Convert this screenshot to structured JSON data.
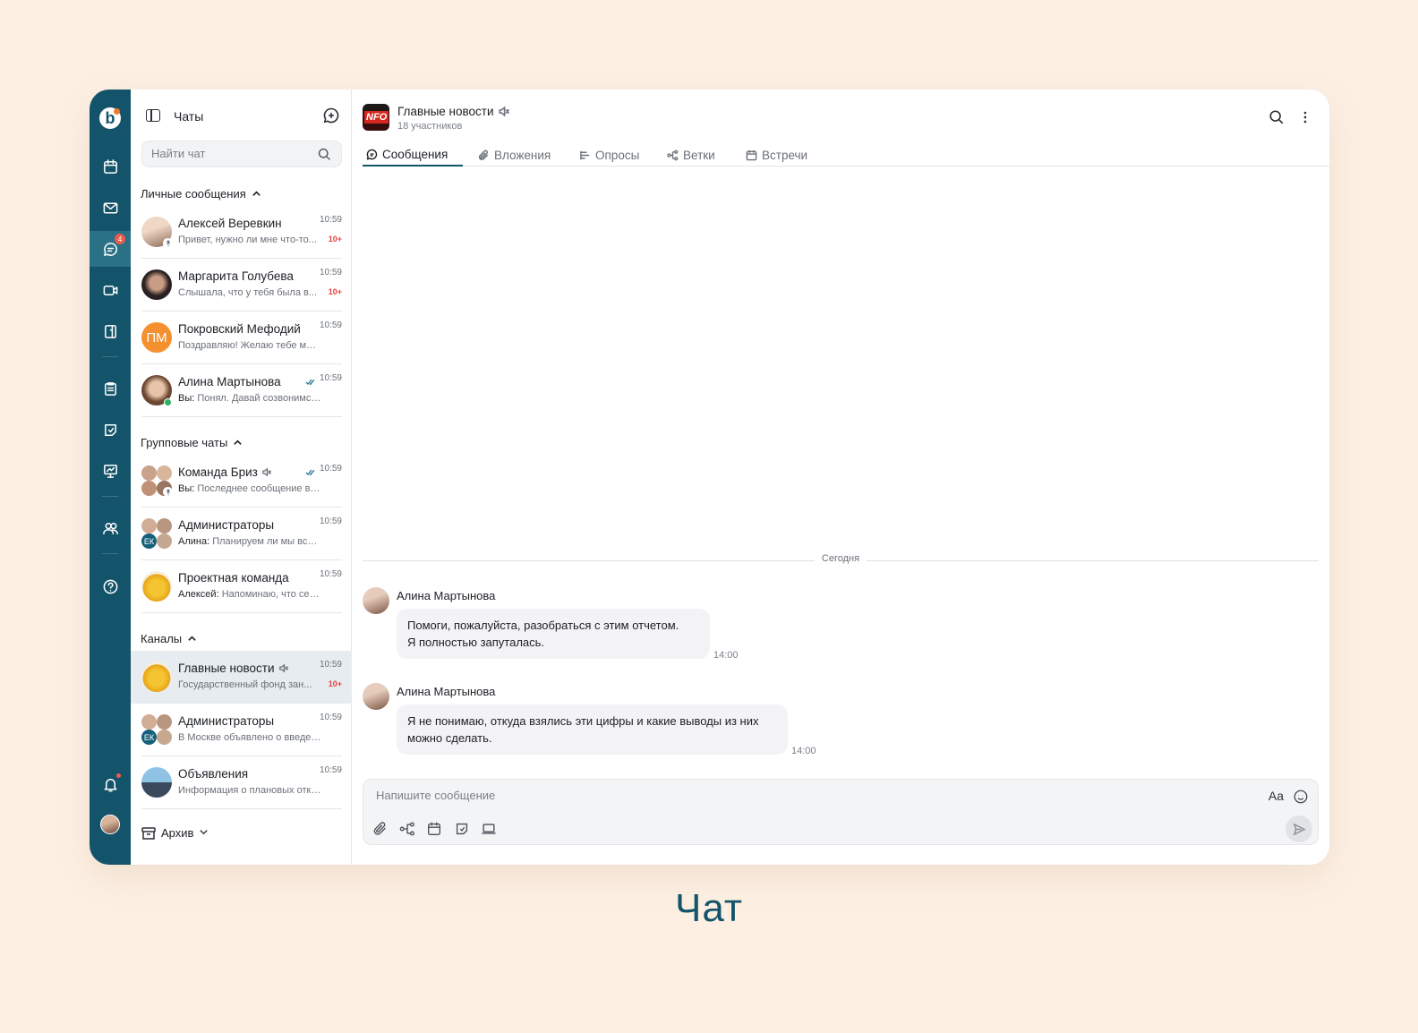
{
  "sidebar": {
    "title": "Чаты",
    "search_placeholder": "Найти чат",
    "sections": {
      "personal": "Личные сообщения",
      "groups": "Групповые чаты",
      "channels": "Каналы"
    },
    "personal_chats": [
      {
        "name": "Алексей Веревкин",
        "time": "10:59",
        "preview": "Привет, нужно ли мне что-то...",
        "unread": "10+"
      },
      {
        "name": "Маргарита Голубева",
        "time": "10:59",
        "preview": "Слышала, что у тебя была в...",
        "unread": "10+"
      },
      {
        "name": "Покровский Мефодий",
        "initials": "ПМ",
        "time": "10:59",
        "preview": "Поздравляю! Желаю тебе мног..."
      },
      {
        "name": "Алина Мартынова",
        "time": "10:59",
        "sender": "Вы:",
        "preview": "Понял. Давай созвонимся с..."
      }
    ],
    "group_chats": [
      {
        "name": "Команда Бриз",
        "time": "10:59",
        "sender": "Вы:",
        "preview": "Последнее сообщение в эт..."
      },
      {
        "name": "Администраторы",
        "time": "10:59",
        "sender": "Алина:",
        "preview": "Планируем ли мы встре...",
        "tag": "ЕК"
      },
      {
        "name": "Проектная команда",
        "time": "10:59",
        "sender": "Алексей:",
        "preview": "Напоминаю, что сегод..."
      }
    ],
    "channels": [
      {
        "name": "Главные новости",
        "time": "10:59",
        "preview": "Государственный фонд зан...",
        "unread": "10+"
      },
      {
        "name": "Администраторы",
        "time": "10:59",
        "preview": "В Москве объявлено о введени...",
        "tag": "ЕК"
      },
      {
        "name": "Объявления",
        "time": "10:59",
        "preview": "Информация о плановых отклю..."
      }
    ],
    "archive_label": "Архив"
  },
  "rail": {
    "chat_badge": "4"
  },
  "channel": {
    "title": "Главные новости",
    "logo_text": "NFO",
    "members": "18 участников",
    "tabs": [
      "Сообщения",
      "Вложения",
      "Опросы",
      "Ветки",
      "Встречи"
    ]
  },
  "messages": {
    "day": "Сегодня",
    "items": [
      {
        "author": "Алина Мартынова",
        "lines": [
          "Помоги, пожалуйста, разобраться с этим отчетом.",
          "Я полностью запуталась."
        ],
        "time": "14:00"
      },
      {
        "author": "Алина Мартынова",
        "lines": [
          "Я не понимаю, откуда взялись эти цифры и какие выводы из них",
          "можно сделать."
        ],
        "time": "14:00"
      }
    ]
  },
  "composer": {
    "placeholder": "Напишите сообщение",
    "format_label": "Aa"
  },
  "caption": "Чат"
}
